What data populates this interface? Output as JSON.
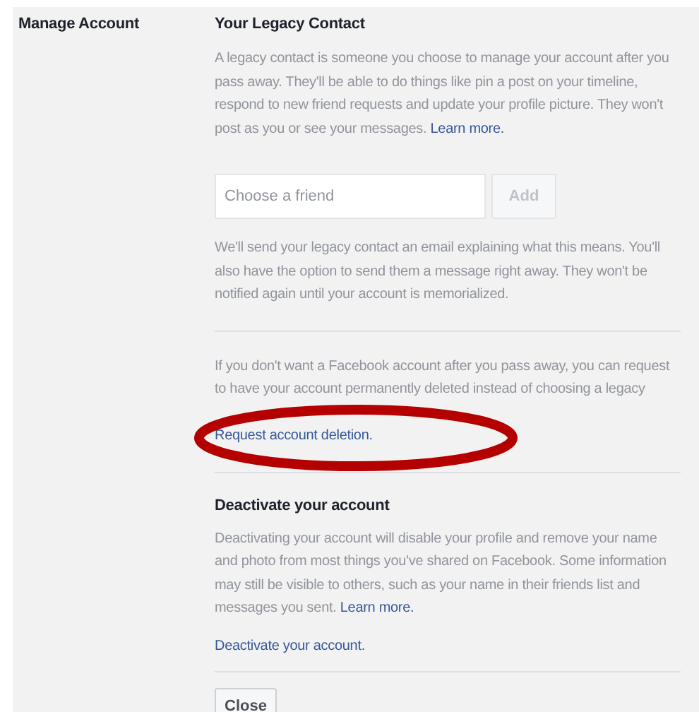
{
  "section_label": "Manage Account",
  "legacy": {
    "heading": "Your Legacy Contact",
    "intro": "A legacy contact is someone you choose to manage your account after you pass away. They'll be able to do things like pin a post on your timeline, respond to new friend requests and update your profile picture. They won't post as you or see your messages. ",
    "intro_link": "Learn more.",
    "friend_field": {
      "placeholder": "Choose a friend"
    },
    "add_button": {
      "label": "Add",
      "disabled": true
    },
    "notice": "We'll send your legacy contact an email explaining what this means. You'll also have the option to send them a message right away. They won't be notified again until your account is memorialized."
  },
  "deletion": {
    "text": "If you don't want a Facebook account after you pass away, you can request to have your account permanently deleted instead of choosing a legacy",
    "link": "Request account deletion.",
    "highlighted": true
  },
  "deactivate": {
    "heading": "Deactivate your account",
    "text": "Deactivating your account will disable your profile and remove your name and photo from most things you've shared on Facebook. Some information may still be visible to others, such as your name in their friends list and messages you sent. ",
    "text_link": "Learn more.",
    "link": "Deactivate your account."
  },
  "close_button": "Close"
}
